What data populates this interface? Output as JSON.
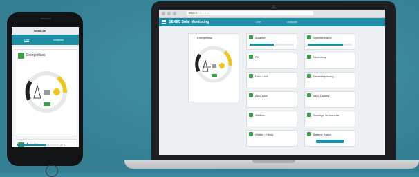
{
  "browser": {
    "url": "https://... / ... / ..."
  },
  "app": {
    "title": "SENEC Solar Monitoring",
    "tabs": [
      "Live",
      "Analysis"
    ]
  },
  "panels": [
    {
      "title": "Energiefluss"
    },
    {
      "title": "Autarkie"
    },
    {
      "title": "Speicherstatus"
    },
    {
      "title": "PV"
    },
    {
      "title": "Netzbezug"
    },
    {
      "title": "Haus Last"
    },
    {
      "title": "Netzeinspeisung"
    },
    {
      "title": "Akku Last"
    },
    {
      "title": "Akku Ladung"
    },
    {
      "title": "Wallbox"
    },
    {
      "title": "Sonstige Verbraucher"
    },
    {
      "title": "Wetter / Ertrag"
    },
    {
      "title": "Batterie Status"
    }
  ],
  "phone": {
    "status_url": "senec.de",
    "tabs": [
      "Live",
      "Analysis"
    ],
    "card_titles": [
      "Energiefluss",
      "Autarkie"
    ],
    "autarky_value": "87 %"
  },
  "colors": {
    "accent": "#1e8ea5",
    "success": "#3a9e4a",
    "warning": "#f0c419",
    "background": "#3a8ba0"
  }
}
